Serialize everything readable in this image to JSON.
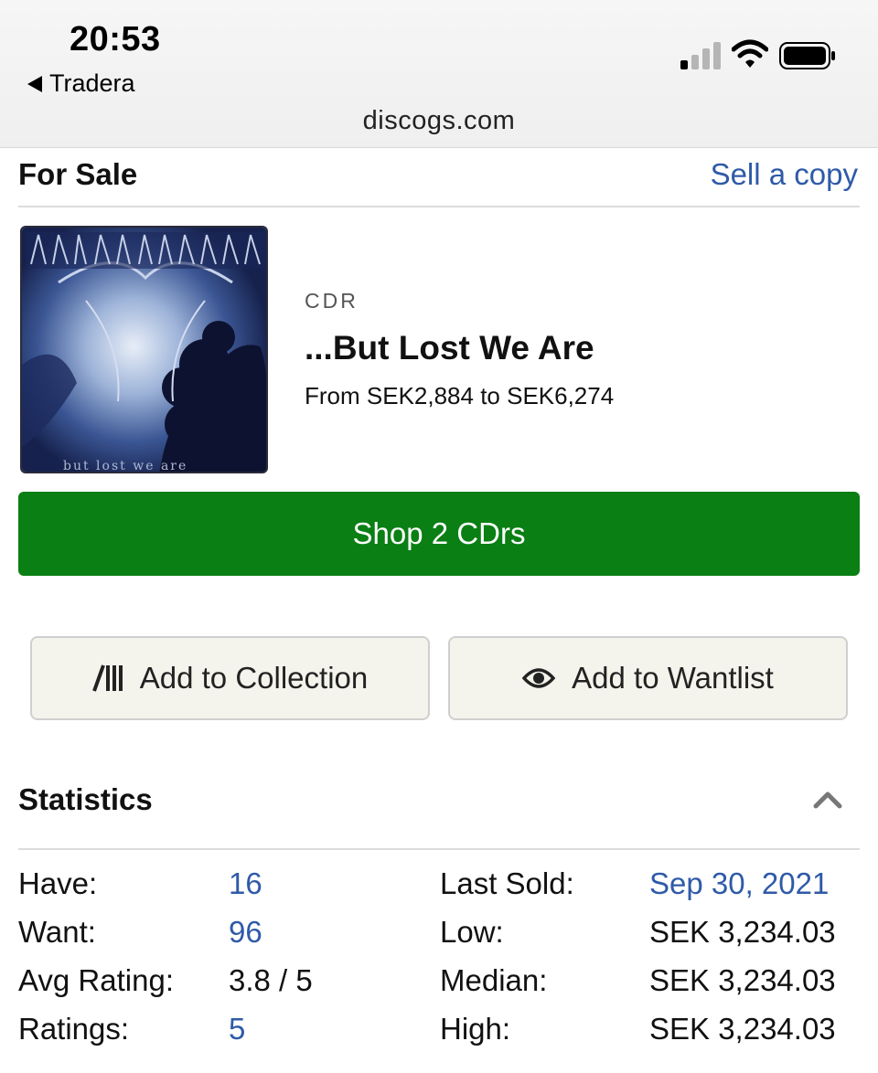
{
  "status_bar": {
    "time": "20:53",
    "back_label": "Tradera",
    "url": "discogs.com"
  },
  "for_sale": {
    "title": "For Sale",
    "sell_link": "Sell a copy"
  },
  "product": {
    "format": "CDR",
    "title": "...But Lost We Are",
    "price_range": "From SEK2,884 to SEK6,274",
    "cover_text_bottom": "but lost we are"
  },
  "shop_button": "Shop 2 CDrs",
  "actions": {
    "collection": "Add to Collection",
    "wantlist": "Add to Wantlist"
  },
  "statistics": {
    "title": "Statistics",
    "left": [
      {
        "label": "Have:",
        "value": "16"
      },
      {
        "label": "Want:",
        "value": "96"
      },
      {
        "label": "Avg Rating:",
        "value": "3.8 / 5"
      },
      {
        "label": "Ratings:",
        "value": "5"
      }
    ],
    "right": [
      {
        "label": "Last Sold:",
        "value": "Sep 30, 2021"
      },
      {
        "label": "Low:",
        "value": "SEK 3,234.03"
      },
      {
        "label": "Median:",
        "value": "SEK 3,234.03"
      },
      {
        "label": "High:",
        "value": "SEK 3,234.03"
      }
    ]
  },
  "colors": {
    "link": "#2f5aa8",
    "shop_green": "#0a7f14",
    "button_bg": "#f4f3ec"
  },
  "icons": {
    "collection": "collection-bars-icon",
    "wantlist": "eye-icon",
    "collapse": "chevron-up-icon"
  }
}
